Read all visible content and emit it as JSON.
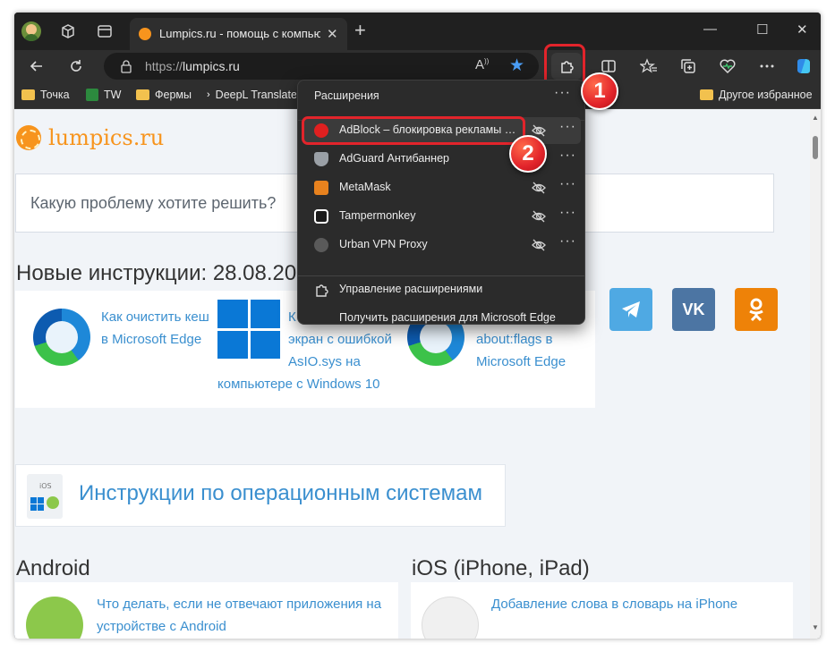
{
  "tab": {
    "title": "Lumpics.ru - помощь с компьюте",
    "close": "✕"
  },
  "newtab": "+",
  "window_controls": {
    "minimize": "—",
    "maximize": "☐",
    "close": "✕"
  },
  "address": {
    "prefix": "https://",
    "domain": "lumpics.ru"
  },
  "bookmarks": [
    {
      "label": "Точка"
    },
    {
      "label": "TW"
    },
    {
      "label": "Фермы"
    },
    {
      "label": "DeepL Translate"
    },
    {
      "label": "Другое избранное"
    }
  ],
  "popup": {
    "title": "Расширения",
    "extensions": [
      {
        "name": "AdBlock – блокировка рекламы в...",
        "color": "#e02020"
      },
      {
        "name": "AdGuard Антибаннер",
        "color": "#9aa0a6"
      },
      {
        "name": "MetaMask",
        "color": "#e8821e"
      },
      {
        "name": "Tampermonkey",
        "color": "#ffffff"
      },
      {
        "name": "Urban VPN Proxy",
        "color": "#5a5a5a"
      }
    ],
    "manage": "Управление расширениями",
    "get": "Получить расширения для Microsoft Edge"
  },
  "badges": {
    "one": "1",
    "two": "2"
  },
  "page": {
    "logo": "lumpics.ru",
    "search_placeholder": "Какую проблему хотите решить?",
    "new_heading": "Новые инструкции: 28.08.2023",
    "news": [
      {
        "line1": "Как очистить кеш",
        "line2": "в Microsoft Edge"
      },
      {
        "line1": "К",
        "line2": "экран с ошибкой",
        "line3": "AsIO.sys на",
        "line4": "компьютере с Windows 10"
      },
      {
        "line1": "about:flags в",
        "line2": "Microsoft Edge"
      }
    ],
    "os_title": "Инструкции по операционным системам",
    "android_heading": "Android",
    "ios_heading": "iOS (iPhone, iPad)",
    "android_link_1": "Что делать, если не отвечают приложения на",
    "android_link_2": "устройстве с Android",
    "ios_link": "Добавление слова в словарь на iPhone"
  }
}
